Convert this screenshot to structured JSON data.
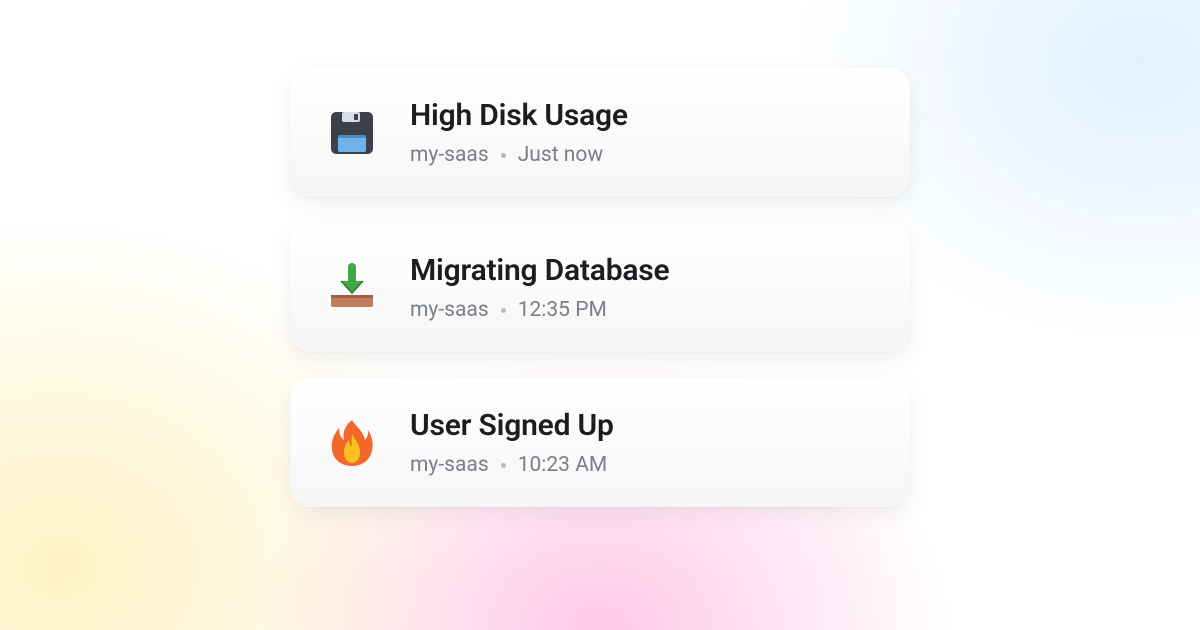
{
  "notifications": [
    {
      "title": "High Disk Usage",
      "project": "my-saas",
      "time": "Just now",
      "icon": "floppy-disk-icon"
    },
    {
      "title": "Migrating Database",
      "project": "my-saas",
      "time": "12:35 PM",
      "icon": "inbox-download-icon"
    },
    {
      "title": "User Signed Up",
      "project": "my-saas",
      "time": "10:23 AM",
      "icon": "fire-icon"
    }
  ]
}
